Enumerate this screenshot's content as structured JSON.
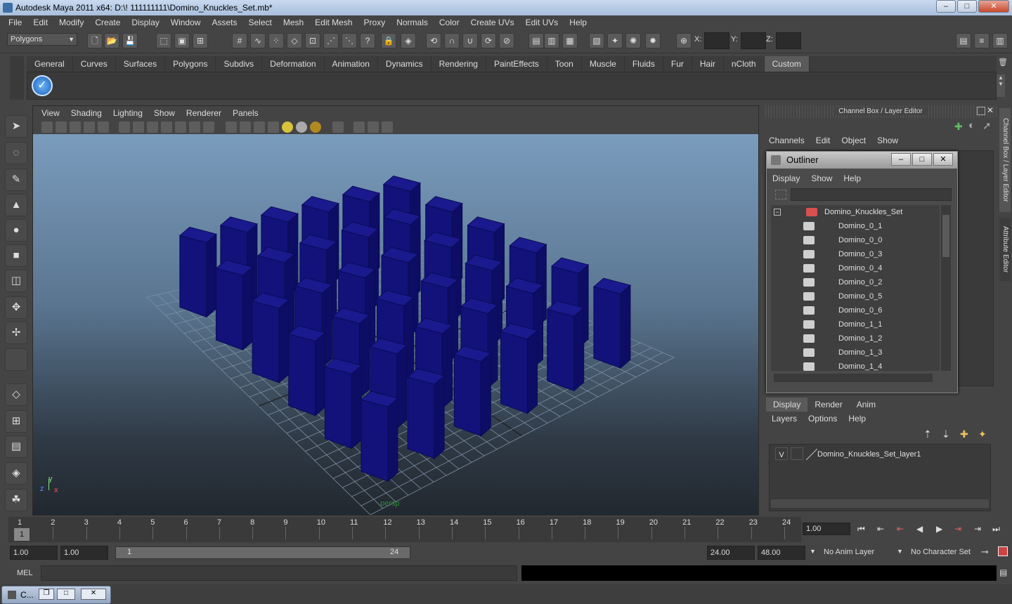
{
  "window": {
    "title": "Autodesk Maya 2011 x64: D:\\! 111111111\\Domino_Knuckles_Set.mb*",
    "min": "–",
    "max": "□",
    "close": "✕"
  },
  "menubar": [
    "File",
    "Edit",
    "Modify",
    "Create",
    "Display",
    "Window",
    "Assets",
    "Select",
    "Mesh",
    "Edit Mesh",
    "Proxy",
    "Normals",
    "Color",
    "Create UVs",
    "Edit UVs",
    "Help"
  ],
  "status": {
    "mode": "Polygons",
    "x_label": "X:",
    "y_label": "Y:",
    "z_label": "Z:"
  },
  "shelf": {
    "tabs": [
      "General",
      "Curves",
      "Surfaces",
      "Polygons",
      "Subdivs",
      "Deformation",
      "Animation",
      "Dynamics",
      "Rendering",
      "PaintEffects",
      "Toon",
      "Muscle",
      "Fluids",
      "Fur",
      "Hair",
      "nCloth",
      "Custom"
    ],
    "active": "Custom",
    "icon": "checkmark-icon"
  },
  "viewport": {
    "menu": [
      "View",
      "Shading",
      "Lighting",
      "Show",
      "Renderer",
      "Panels"
    ],
    "camera": "persp",
    "axis_x": "x",
    "axis_y": "y",
    "axis_z": "z",
    "domino_color": "#12127a"
  },
  "channel_box": {
    "title": "Channel Box / Layer Editor",
    "menu": [
      "Channels",
      "Edit",
      "Object",
      "Show"
    ]
  },
  "outliner": {
    "title": "Outliner",
    "menu": [
      "Display",
      "Show",
      "Help"
    ],
    "root": "Domino_Knuckles_Set",
    "items": [
      "Domino_0_1",
      "Domino_0_0",
      "Domino_0_3",
      "Domino_0_4",
      "Domino_0_2",
      "Domino_0_5",
      "Domino_0_6",
      "Domino_1_1",
      "Domino_1_2",
      "Domino_1_3",
      "Domino_1_4"
    ]
  },
  "layer_editor": {
    "tabs": [
      "Display",
      "Render",
      "Anim"
    ],
    "active": "Display",
    "menu": [
      "Layers",
      "Options",
      "Help"
    ],
    "layer": {
      "visible": "V",
      "name": "Domino_Knuckles_Set_layer1"
    }
  },
  "side_tabs": {
    "channel_box": "Channel Box / Layer Editor",
    "attribute_editor": "Attribute Editor"
  },
  "timeline": {
    "ticks": [
      "1",
      "2",
      "3",
      "4",
      "5",
      "6",
      "7",
      "8",
      "9",
      "10",
      "11",
      "12",
      "13",
      "14",
      "15",
      "16",
      "17",
      "18",
      "19",
      "20",
      "21",
      "22",
      "23",
      "24"
    ],
    "current_frame_marker": "1",
    "current_time": "1.00"
  },
  "range": {
    "start": "1.00",
    "playback_start": "1.00",
    "range_start_label": "1",
    "range_end_label": "24",
    "playback_end": "24.00",
    "end": "48.00",
    "anim_layer": "No Anim Layer",
    "character_set": "No Character Set"
  },
  "command_line": {
    "label": "MEL"
  },
  "taskbar": {
    "label": "C..."
  }
}
